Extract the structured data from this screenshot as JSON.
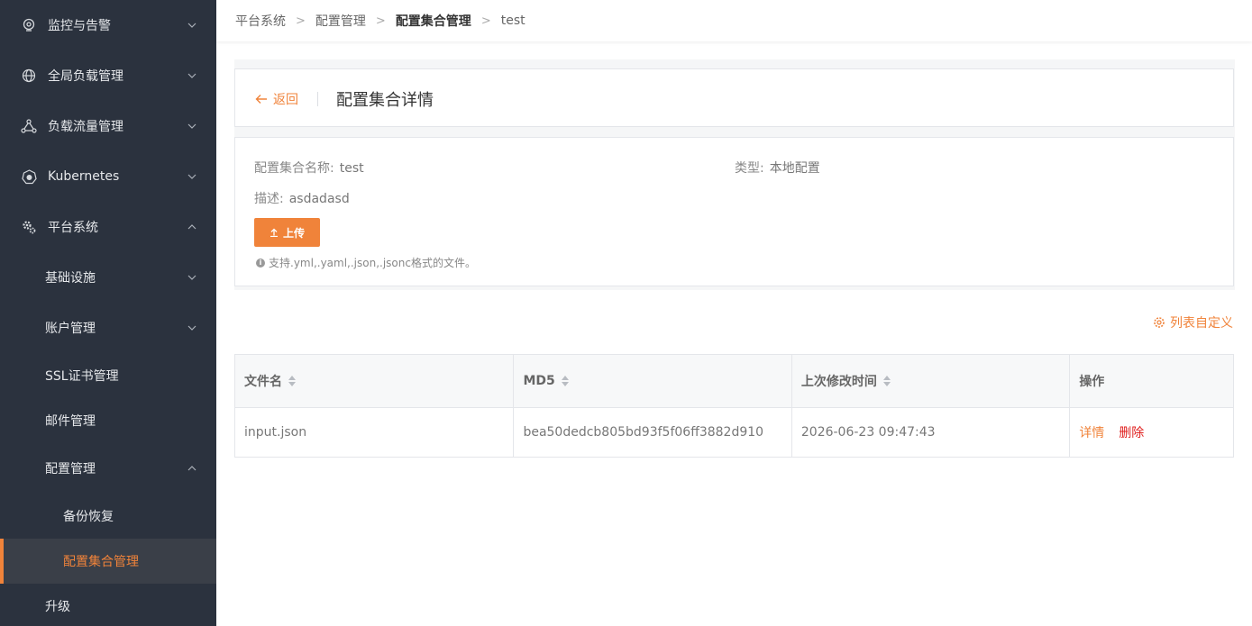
{
  "colors": {
    "accent": "#f0833a",
    "sidebar_bg": "#2b323e",
    "danger": "#e0201f"
  },
  "sidebar": {
    "items": [
      {
        "label": "监控与告警",
        "icon": "monitor-pin-icon",
        "arrow": "down"
      },
      {
        "label": "全局负载管理",
        "icon": "globe-icon",
        "arrow": "down"
      },
      {
        "label": "负载流量管理",
        "icon": "network-nodes-icon",
        "arrow": "down"
      },
      {
        "label": "Kubernetes",
        "icon": "kubernetes-icon",
        "arrow": "down"
      },
      {
        "label": "平台系统",
        "icon": "gears-icon",
        "arrow": "up"
      },
      {
        "label": "基础设施",
        "arrow": "down"
      },
      {
        "label": "账户管理",
        "arrow": "down"
      },
      {
        "label": "SSL证书管理"
      },
      {
        "label": "邮件管理"
      },
      {
        "label": "配置管理",
        "arrow": "up"
      },
      {
        "label": "备份恢复"
      },
      {
        "label": "配置集合管理",
        "active": true
      },
      {
        "label": "升级"
      }
    ]
  },
  "breadcrumb": [
    "平台系统",
    "配置管理",
    "配置集合管理",
    "test"
  ],
  "header": {
    "back_label": "返回",
    "title": "配置集合详情"
  },
  "info": {
    "name_label": "配置集合名称:",
    "name_value": "test",
    "type_label": "类型:",
    "type_value": "本地配置",
    "desc_label": "描述:",
    "desc_value": "asdadasd",
    "upload_label": "上传",
    "hint": "支持.yml,.yaml,.json,.jsonc格式的文件。"
  },
  "table_tools": {
    "customize_label": "列表自定义"
  },
  "table": {
    "columns": [
      "文件名",
      "MD5",
      "上次修改时间",
      "操作"
    ],
    "rows": [
      {
        "filename": "input.json",
        "md5": "bea50dedcb805bd93f5f06ff3882d910",
        "modified": "2026-06-23 09:47:43",
        "actions": [
          "详情",
          "删除"
        ]
      }
    ]
  }
}
